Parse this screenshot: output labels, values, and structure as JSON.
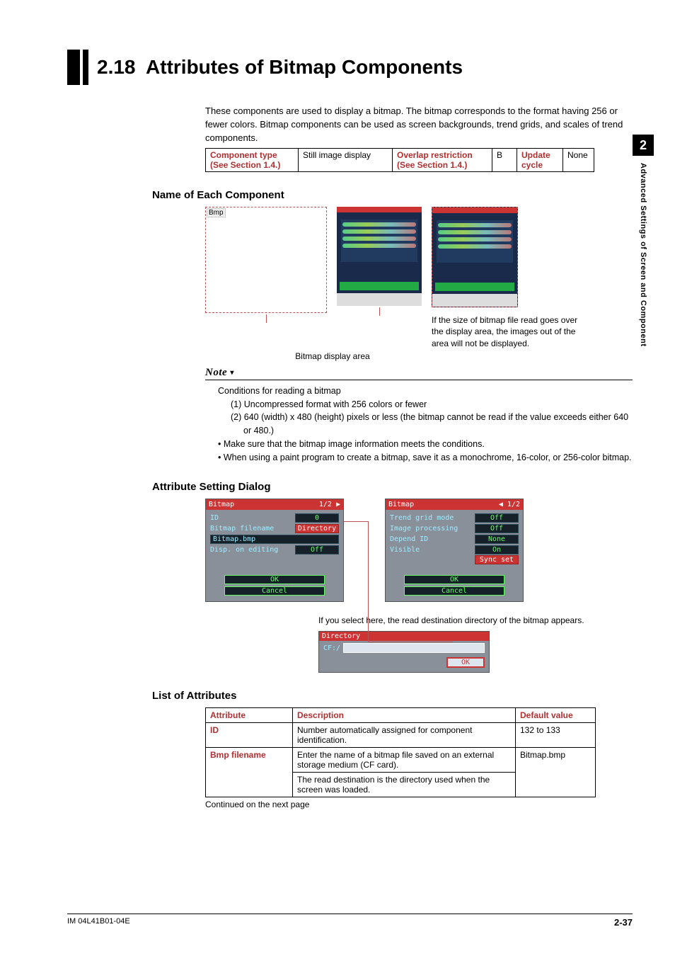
{
  "sideTab": {
    "chapter": "2",
    "title": "Advanced Settings of Screen and Component"
  },
  "heading": {
    "num": "2.18",
    "title": "Attributes of Bitmap Components"
  },
  "intro": {
    "p1": "These components are used to display a bitmap. The bitmap corresponds to the format having 256 or fewer colors. Bitmap components can be used as screen backgrounds, trend grids, and scales of trend components."
  },
  "infoTable": {
    "c1label": "Component type",
    "c1see": "(See Section 1.4.)",
    "c1val": "Still image display",
    "c2label": "Overlap restriction",
    "c2see": "(See Section 1.4.)",
    "c2val": "B",
    "c3label": "Update cycle",
    "c3val": "None"
  },
  "sect1": {
    "title": "Name of Each Component",
    "figTag": "Bmp",
    "caption": "Bitmap display area",
    "sideNote": "If the size of bitmap file read goes over the display area, the images out of the area will not be displayed."
  },
  "note": {
    "head": "Note",
    "line1": "Conditions for reading a bitmap",
    "i1": "(1) Uncompressed format with 256 colors or fewer",
    "i2": "(2) 640 (width) x 480 (height) pixels or less (the bitmap cannot be read if the value exceeds either 640 or 480.)",
    "b1": "•   Make sure that the bitmap image information meets the conditions.",
    "b2": "•   When using a paint program to create a bitmap, save it as a monochrome, 16-color, or 256-color bitmap."
  },
  "sect2": {
    "title": "Attribute Setting Dialog"
  },
  "dlg1": {
    "title": "Bitmap",
    "page": "1/2 ▶",
    "rows": {
      "id": {
        "label": "ID",
        "val": "0"
      },
      "file": {
        "label": "Bitmap filename",
        "val": "Directory"
      },
      "fileline": "Bitmap.bmp",
      "disp": {
        "label": "Disp. on editing",
        "val": "Off"
      }
    },
    "ok": "OK",
    "cancel": "Cancel"
  },
  "dlg2": {
    "title": "Bitmap",
    "page": "◀ 1/2",
    "rows": {
      "grid": {
        "label": "Trend grid mode",
        "val": "Off"
      },
      "proc": {
        "label": "Image processing",
        "val": "Off"
      },
      "depend": {
        "label": "Depend ID",
        "val": "None"
      },
      "vis": {
        "label": "Visible",
        "val": "On"
      }
    },
    "sync": "Sync set",
    "ok": "OK",
    "cancel": "Cancel"
  },
  "dirNote": "If you select here, the read destination directory of the bitmap appears.",
  "dirDlg": {
    "title": "Directory",
    "cf": "CF:/",
    "ok": "OK"
  },
  "sect3": {
    "title": "List of Attributes"
  },
  "attrTable": {
    "h1": "Attribute",
    "h2": "Description",
    "h3": "Default value",
    "rows": [
      {
        "name": "ID",
        "desc": "Number automatically assigned for component identification.",
        "def": "132 to 133"
      },
      {
        "name": "Bmp filename",
        "desc1": "Enter the name of a bitmap file saved on an external storage medium (CF card).",
        "desc2": "The read destination is the directory used when the screen was loaded.",
        "def": "Bitmap.bmp"
      }
    ]
  },
  "continued": "Continued on the next page",
  "footer": {
    "left": "IM 04L41B01-04E",
    "right": "2-37"
  }
}
